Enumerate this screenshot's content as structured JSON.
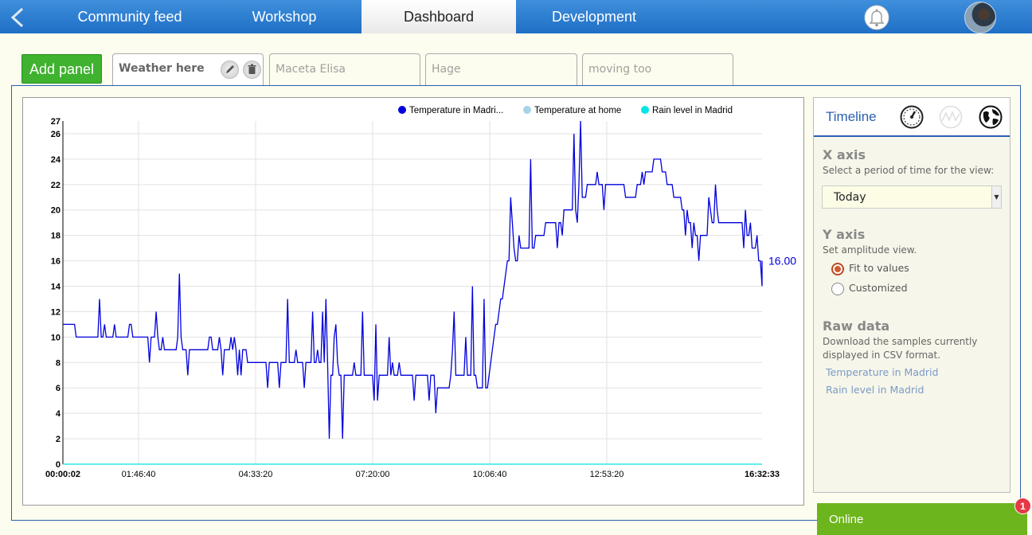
{
  "nav": {
    "tabs": [
      "Community feed",
      "Workshop",
      "Dashboard",
      "Development"
    ],
    "active_tab": "Dashboard"
  },
  "panels": {
    "add_label": "Add panel",
    "tabs": [
      "Weather here",
      "Maceta Elisa",
      "Hage",
      "moving too"
    ],
    "active": "Weather here"
  },
  "side": {
    "title": "Timeline",
    "x_axis_title": "X axis",
    "x_axis_desc": "Select a period of time for the view:",
    "period_value": "Today",
    "y_axis_title": "Y axis",
    "y_axis_desc": "Set amplitude view.",
    "radio_fit": "Fit to values",
    "radio_custom": "Customized",
    "raw_title": "Raw data",
    "raw_desc_1": "Download the samples currently",
    "raw_desc_2": "displayed in CSV format.",
    "download_links": [
      "Temperature in Madrid",
      "Rain level in Madrid"
    ]
  },
  "status": {
    "label": "Online",
    "badge": "1"
  },
  "colors": {
    "nav": "#2f7fd4",
    "accent": "#3fb22f",
    "series1": "#0000dd",
    "series2": "#a8d2e6",
    "series3": "#00e5e5",
    "online": "#6db51c"
  },
  "chart_data": {
    "type": "line",
    "legend": [
      "Temperature in Madri...",
      "Temperature at home",
      "Rain level in Madrid"
    ],
    "legend_placement": "top-right",
    "y_ticks": [
      0,
      2,
      4,
      6,
      8,
      10,
      12,
      14,
      16,
      18,
      20,
      22,
      24,
      26,
      27
    ],
    "ylim": [
      0,
      27
    ],
    "x_tick_labels": [
      "00:00:02",
      "01:46:40",
      "04:33:20",
      "07:20:00",
      "10:06:40",
      "12:53:20",
      "16:32:33"
    ],
    "last_value_label": "16.00",
    "grid": true,
    "series": [
      {
        "name": "Temperature in Madrid",
        "x": [
          "00:00",
          "00:30",
          "01:00",
          "01:30",
          "02:00",
          "02:30",
          "03:00",
          "03:30",
          "04:00",
          "04:30",
          "05:00",
          "05:30",
          "06:00",
          "06:30",
          "07:00",
          "07:30",
          "08:00",
          "08:30",
          "09:00",
          "09:30",
          "10:00",
          "10:30",
          "11:00",
          "11:30",
          "12:00",
          "12:30",
          "13:00",
          "13:30",
          "14:00",
          "14:30",
          "15:00",
          "15:30",
          "16:00",
          "16:30"
        ],
        "values": [
          11,
          10,
          10,
          10,
          10,
          9,
          9,
          9,
          9,
          8,
          8,
          8,
          8,
          7,
          7,
          7,
          7,
          7,
          6,
          7,
          6,
          16,
          17,
          19,
          20,
          22,
          22,
          21,
          24,
          21,
          18,
          19,
          19,
          16
        ],
        "peaks": [
          15,
          13,
          13,
          16,
          15,
          15,
          12,
          12,
          12,
          11,
          15,
          15,
          14,
          14,
          14,
          12,
          7,
          13,
          13,
          19,
          21,
          22,
          25,
          25,
          27,
          24,
          27,
          21,
          27,
          25,
          22,
          23,
          23,
          21
        ]
      },
      {
        "name": "Temperature at home",
        "values": []
      },
      {
        "name": "Rain level in Madrid",
        "values": [
          0,
          0,
          0,
          0,
          0,
          0,
          0,
          0,
          0,
          0,
          0,
          0,
          0,
          0,
          0,
          0,
          0,
          0,
          0,
          0,
          0,
          0,
          0,
          0,
          0,
          0,
          0,
          0,
          0,
          0,
          0,
          0,
          0,
          0
        ]
      }
    ]
  }
}
